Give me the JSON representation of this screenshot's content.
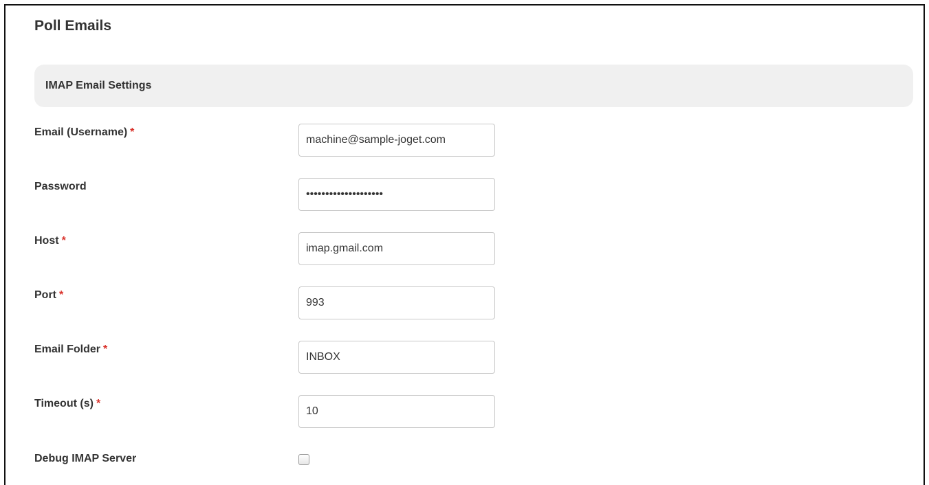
{
  "page": {
    "title": "Poll Emails"
  },
  "section": {
    "title": "IMAP Email Settings"
  },
  "fields": [
    {
      "label": "Email (Username)",
      "required": true,
      "value": "machine@sample-joget.com",
      "type": "text"
    },
    {
      "label": "Password",
      "required": false,
      "value": "********************",
      "type": "password"
    },
    {
      "label": "Host",
      "required": true,
      "value": "imap.gmail.com",
      "type": "text"
    },
    {
      "label": "Port",
      "required": true,
      "value": "993",
      "type": "text"
    },
    {
      "label": "Email Folder",
      "required": true,
      "value": "INBOX",
      "type": "text"
    },
    {
      "label": "Timeout (s)",
      "required": true,
      "value": "10",
      "type": "text"
    }
  ],
  "debug": {
    "label": "Debug IMAP Server",
    "checked": false
  },
  "required_marker": "*",
  "colors": {
    "required": "#d9322b",
    "section_bg": "#f0f0f0",
    "text": "#333333"
  }
}
